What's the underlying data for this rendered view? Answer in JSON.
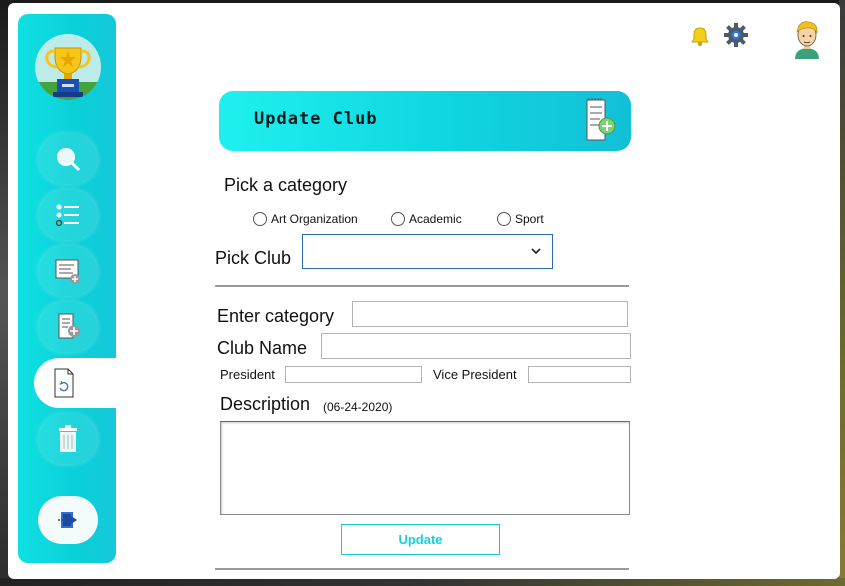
{
  "sidebar": {
    "logo_icon": "trophy-icon",
    "items": [
      {
        "name": "search",
        "icon": "search-icon"
      },
      {
        "name": "list",
        "icon": "list-icon"
      },
      {
        "name": "view-clubs",
        "icon": "document-list-icon"
      },
      {
        "name": "add-club",
        "icon": "document-add-icon"
      },
      {
        "name": "update-club",
        "icon": "document-refresh-icon",
        "active": true
      },
      {
        "name": "delete-club",
        "icon": "trash-icon"
      }
    ],
    "logout_icon": "exit-icon"
  },
  "topbar": {
    "icons": [
      "bell-icon",
      "gear-icon",
      "user-avatar-icon"
    ]
  },
  "header": {
    "title": "Update Club",
    "icon": "document-add-icon"
  },
  "form": {
    "category_prompt": "Pick a category",
    "category_options": [
      {
        "label": "Art Organization",
        "selected": false
      },
      {
        "label": "Academic",
        "selected": false
      },
      {
        "label": "Sport",
        "selected": false
      }
    ],
    "pick_club_label": "Pick Club",
    "pick_club_value": "",
    "enter_category_label": "Enter category",
    "enter_category_value": "",
    "club_name_label": "Club Name",
    "club_name_value": "",
    "president_label": "President",
    "president_value": "",
    "vice_president_label": "Vice President",
    "vice_president_value": "",
    "description_label": "Description",
    "description_date": "(06-24-2020)",
    "description_value": "",
    "update_button": "Update"
  },
  "colors": {
    "accent": "#0fd6df",
    "update_text": "#19d0da"
  }
}
